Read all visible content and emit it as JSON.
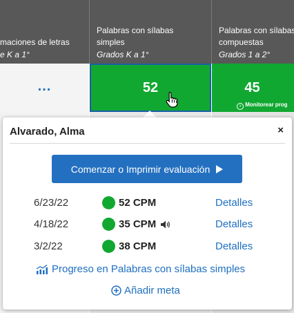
{
  "columns": [
    {
      "title": "maciones de letras",
      "grades": "e K a 1°"
    },
    {
      "title_line1": "Palabras con sílabas",
      "title_line2": "simples",
      "grades": "Grados K a 1°"
    },
    {
      "title_line1": "Palabras con sílabas",
      "title_line2": "compuestas",
      "grades": "Grados 1 a 2°"
    }
  ],
  "cells": {
    "col1": "...",
    "col2_score": "52",
    "col3_score": "45",
    "col3_monitor": "Monitorear prog"
  },
  "popup": {
    "student_name": "Alvarado, Alma",
    "close": "×",
    "start_button": "Comenzar o Imprimir evaluación",
    "results": [
      {
        "date": "6/23/22",
        "cpm": "52 CPM",
        "details": "Detalles",
        "audio": false
      },
      {
        "date": "4/18/22",
        "cpm": "35 CPM",
        "details": "Detalles",
        "audio": true
      },
      {
        "date": "3/2/22",
        "cpm": "38 CPM",
        "details": "Detalles",
        "audio": false
      }
    ],
    "progress_link": "Progreso en Palabras con sílabas simples",
    "add_goal": "Añadir meta"
  },
  "colors": {
    "header": "#585858",
    "green": "#11a831",
    "link": "#1e6fc0",
    "button": "#2470c0"
  }
}
